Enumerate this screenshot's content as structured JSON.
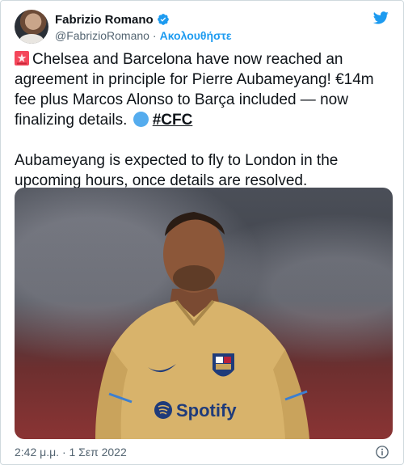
{
  "author": {
    "display_name": "Fabrizio Romano",
    "handle": "@FabrizioRomano",
    "separator": "·",
    "follow_label": "Ακολουθήστε"
  },
  "tweet": {
    "paragraph_1": "Chelsea and Barcelona have now reached an agreement in principle for Pierre Aubameyang! €14m fee plus Marcos Alonso to Barça included — now finalizing details.",
    "hashtag": "#CFC",
    "paragraph_2": "Aubameyang is expected to fly to London in the upcoming hours, once details are resolved."
  },
  "media": {
    "shirt_text": "Spotify"
  },
  "footer": {
    "timestamp": "2:42 μ.μ. · 1 Σεπ 2022"
  },
  "colors": {
    "accent": "#1d9bf0",
    "verified": "#1d9bf0",
    "siren": "#f4475b",
    "shirt": "#d8b36b"
  },
  "icons": {
    "verified": "verified-badge-icon",
    "twitter": "twitter-bird-icon",
    "siren": "rotating-light-emoji",
    "circle": "blue-circle-emoji",
    "info": "info-icon"
  }
}
